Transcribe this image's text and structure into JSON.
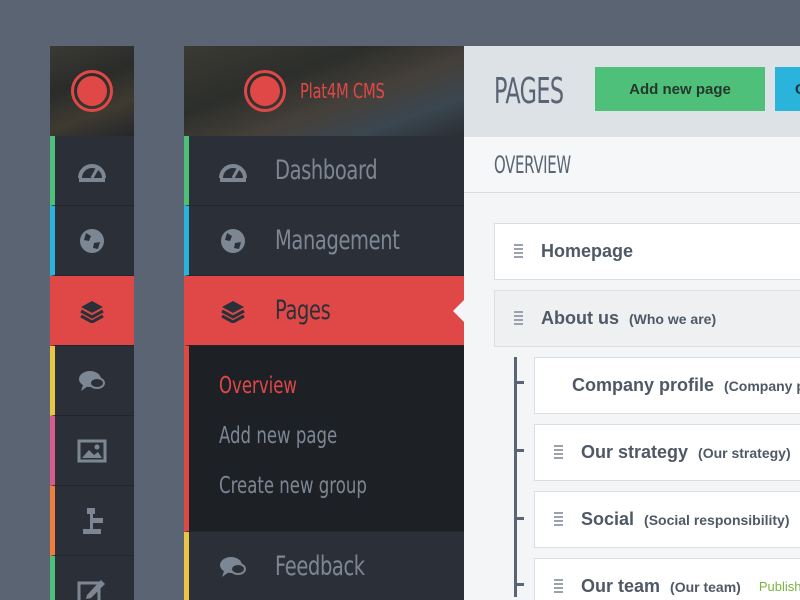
{
  "colors": {
    "accent": "#e04848",
    "green_add": "#4ec07a",
    "blue": "#2ab4dc",
    "sidebar_bg": "#2b3038"
  },
  "brand": {
    "name": "Plat4M CMS",
    "logo_icon": "record-icon"
  },
  "narrow_nav": [
    {
      "icon": "dashboard-icon",
      "stripe": "#4ec07a"
    },
    {
      "icon": "globe-icon",
      "stripe": "#2ab4dc"
    },
    {
      "icon": "layers-icon",
      "stripe": "#e04848",
      "active": true
    },
    {
      "icon": "feedback-icon",
      "stripe": "#e8c547"
    },
    {
      "icon": "image-icon",
      "stripe": "#d65a8c"
    },
    {
      "icon": "sitemap-icon",
      "stripe": "#ef7e3c"
    },
    {
      "icon": "edit-icon",
      "stripe": "#4ec07a"
    }
  ],
  "nav": {
    "dashboard": "Dashboard",
    "management": "Management",
    "pages": "Pages",
    "feedback": "Feedback"
  },
  "submenu": {
    "overview": "Overview",
    "add_new_page": "Add new page",
    "create_new_group": "Create new group"
  },
  "header": {
    "title": "PAGES",
    "add_button": "Add new page",
    "second_button": "C"
  },
  "section": {
    "title": "OVERVIEW"
  },
  "pages_list": [
    {
      "name": "Homepage",
      "sub": ""
    },
    {
      "name": "About us",
      "sub": "(Who we are)"
    },
    {
      "name": "Company profile",
      "sub": "(Company profile)"
    },
    {
      "name": "Our strategy",
      "sub": "(Our strategy)"
    },
    {
      "name": "Social",
      "sub": "(Social responsibility)"
    },
    {
      "name": "Our team",
      "sub": "(Our team)",
      "status": "Published"
    }
  ]
}
